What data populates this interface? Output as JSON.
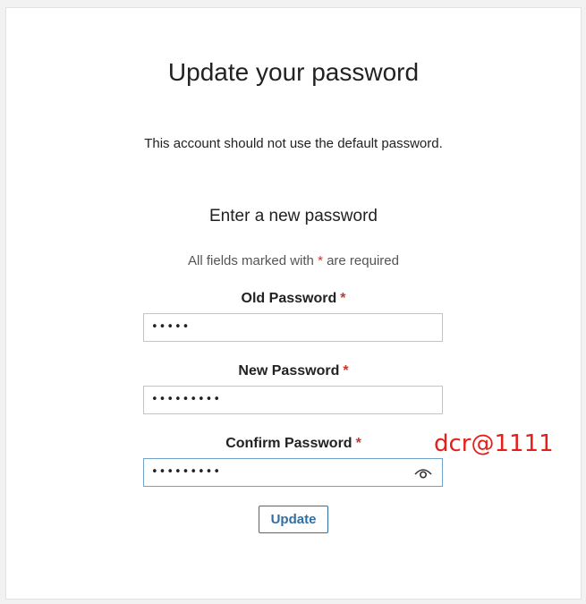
{
  "page": {
    "title": "Update your password",
    "subtitle": "This account should not use the default password.",
    "section_title": "Enter a new password",
    "required_note_prefix": "All fields marked with ",
    "required_marker": "*",
    "required_note_suffix": " are required"
  },
  "fields": {
    "old_password": {
      "label": "Old Password",
      "value": "•••••"
    },
    "new_password": {
      "label": "New Password",
      "value": "•••••••••"
    },
    "confirm_password": {
      "label": "Confirm Password",
      "value": "•••••••••"
    }
  },
  "annotation": "dcr@1111",
  "buttons": {
    "update_label": "Update"
  },
  "icons": {
    "reveal": "eye-icon"
  },
  "colors": {
    "accent": "#2f6fa3",
    "required": "#c0392b",
    "annotation": "#e5201b"
  }
}
